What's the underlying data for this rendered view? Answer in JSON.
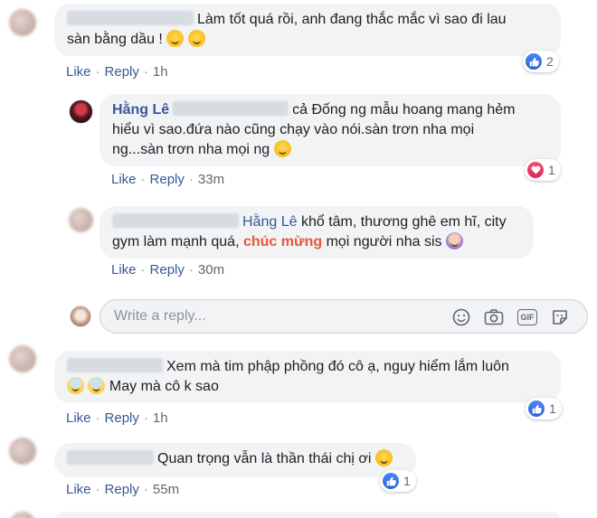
{
  "comments": [
    {
      "text_line1": "Làm tốt quá rồi, anh đang thắc mắc vì sao đi lau",
      "text_line2": "sàn bằng dầu !",
      "like": "Like",
      "reply": "Reply",
      "time": "1h",
      "reactions": {
        "type": "like",
        "count": "2"
      }
    },
    {
      "author": "Hằng Lê",
      "text_line1": "cả Đống ng mẫu hoang mang hẻm",
      "text_line2": "hiểu vì sao.đứa nào cũng chạy vào nói.sàn trơn nha mọi",
      "text_line3": "ng...sàn trơn nha mọi ng",
      "like": "Like",
      "reply": "Reply",
      "time": "33m",
      "reactions": {
        "type": "love",
        "count": "1"
      }
    },
    {
      "mention": "Hằng Lê",
      "text_line1": "khổ tâm, thương ghê em hĩ, city",
      "text_line2a": "gym làm mạnh quá,",
      "highlight": "chúc mừng",
      "text_line2b": "mọi người nha sis",
      "like": "Like",
      "reply": "Reply",
      "time": "30m"
    },
    {
      "text_line1": "Xem mà tim phập phồng đó cô ạ, nguy hiểm lắm luôn",
      "text_line2": "May mà cô k sao",
      "like": "Like",
      "reply": "Reply",
      "time": "1h",
      "reactions": {
        "type": "like",
        "count": "1"
      }
    },
    {
      "text_line1": "Quan trọng vẫn là thần thái chị ơi",
      "like": "Like",
      "reply": "Reply",
      "time": "55m",
      "reactions": {
        "type": "like",
        "count": "1"
      }
    }
  ],
  "reply_box": {
    "placeholder": "Write a reply...",
    "icons": [
      "emoji-icon",
      "camera-icon",
      "gif-icon",
      "sticker-icon"
    ]
  },
  "colors": {
    "link": "#385898",
    "highlight": "#e6573b",
    "bubble": "#f2f3f5",
    "like": "#2a62d9",
    "love": "#e0245e"
  }
}
